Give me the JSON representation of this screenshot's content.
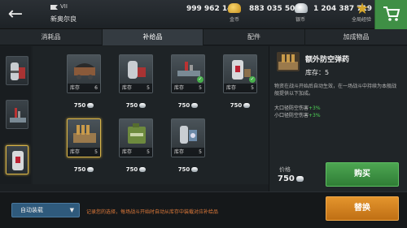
{
  "header": {
    "back_icon": "back-arrow-icon",
    "tier": "VII",
    "ship_name": "新奥尔良",
    "gold": {
      "amount": "999 962 149",
      "label": "金币"
    },
    "silver": {
      "amount": "883 035 504",
      "label": "银币"
    },
    "xp": {
      "amount": "1 204 387 719",
      "label": "全局经验"
    },
    "cart_icon": "shopping-cart-icon"
  },
  "tabs": [
    {
      "label": "消耗品"
    },
    {
      "label": "补给品"
    },
    {
      "label": "配件"
    },
    {
      "label": "加成物品"
    }
  ],
  "grid": {
    "items": [
      {
        "stock_label": "库存",
        "stock": "6",
        "price": "750",
        "equipped": false
      },
      {
        "stock_label": "库存",
        "stock": "5",
        "price": "750",
        "equipped": false
      },
      {
        "stock_label": "库存",
        "stock": "5",
        "price": "750",
        "equipped": true
      },
      {
        "stock_label": "库存",
        "stock": "5",
        "price": "750",
        "equipped": true
      },
      {
        "stock_label": "库存",
        "stock": "5",
        "price": "750",
        "equipped": false
      },
      {
        "stock_label": "库存",
        "stock": "5",
        "price": "750",
        "equipped": false
      },
      {
        "stock_label": "库存",
        "stock": "5",
        "price": "750",
        "equipped": false
      }
    ]
  },
  "detail": {
    "title": "额外防空弹药",
    "stock": "库存：5",
    "description": "物资在战斗开始后自动生效，在一场战斗中持续为本舰战舰提供以下加成。",
    "effect1_label": "大口径防空伤害",
    "effect1_value": "+3%",
    "effect2_label": "小口径防空伤害",
    "effect2_value": "+3%",
    "price_label": "价格",
    "price": "750",
    "buy_label": "购买"
  },
  "footer": {
    "auto_label": "自动装载",
    "auto_note": "记录您的选择，每场战斗开始时自动从库存中装载对应补给品",
    "replace_label": "替换"
  },
  "colors": {
    "accent_green": "#3f8f45",
    "accent_orange": "#d9841f",
    "selection_gold": "#d8b448"
  }
}
